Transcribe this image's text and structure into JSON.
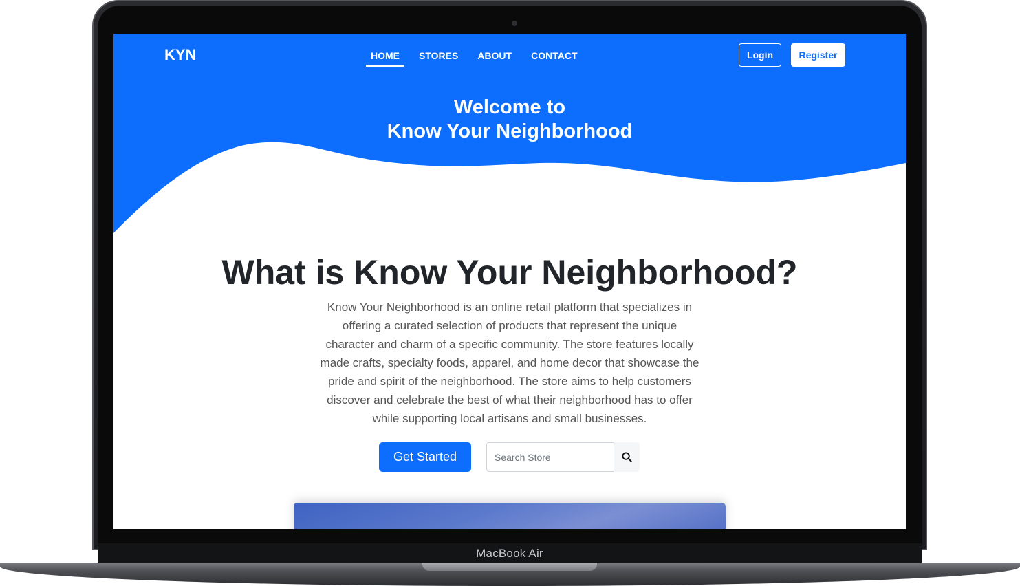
{
  "device": {
    "label": "MacBook Air"
  },
  "navbar": {
    "brand": "KYN",
    "links": [
      {
        "label": "HOME",
        "active": true
      },
      {
        "label": "STORES",
        "active": false
      },
      {
        "label": "ABOUT",
        "active": false
      },
      {
        "label": "CONTACT",
        "active": false
      }
    ],
    "login_label": "Login",
    "register_label": "Register"
  },
  "hero": {
    "line1": "Welcome to",
    "line2": "Know Your Neighborhood"
  },
  "main": {
    "title": "What is Know Your Neighborhood?",
    "description": "Know Your Neighborhood is an online retail platform that specializes in offering a curated selection of products that represent the unique character and charm of a specific community. The store features locally made crafts, specialty foods, apparel, and home decor that showcase the pride and spirit of the neighborhood. The store aims to help customers discover and celebrate the best of what their neighborhood has to offer while supporting local artisans and small businesses.",
    "get_started_label": "Get Started"
  },
  "search": {
    "placeholder": "Search Store",
    "value": "",
    "icon": "search-icon"
  },
  "colors": {
    "primary": "#0d6efd",
    "text_dark": "#212529",
    "text_muted": "#555555"
  }
}
